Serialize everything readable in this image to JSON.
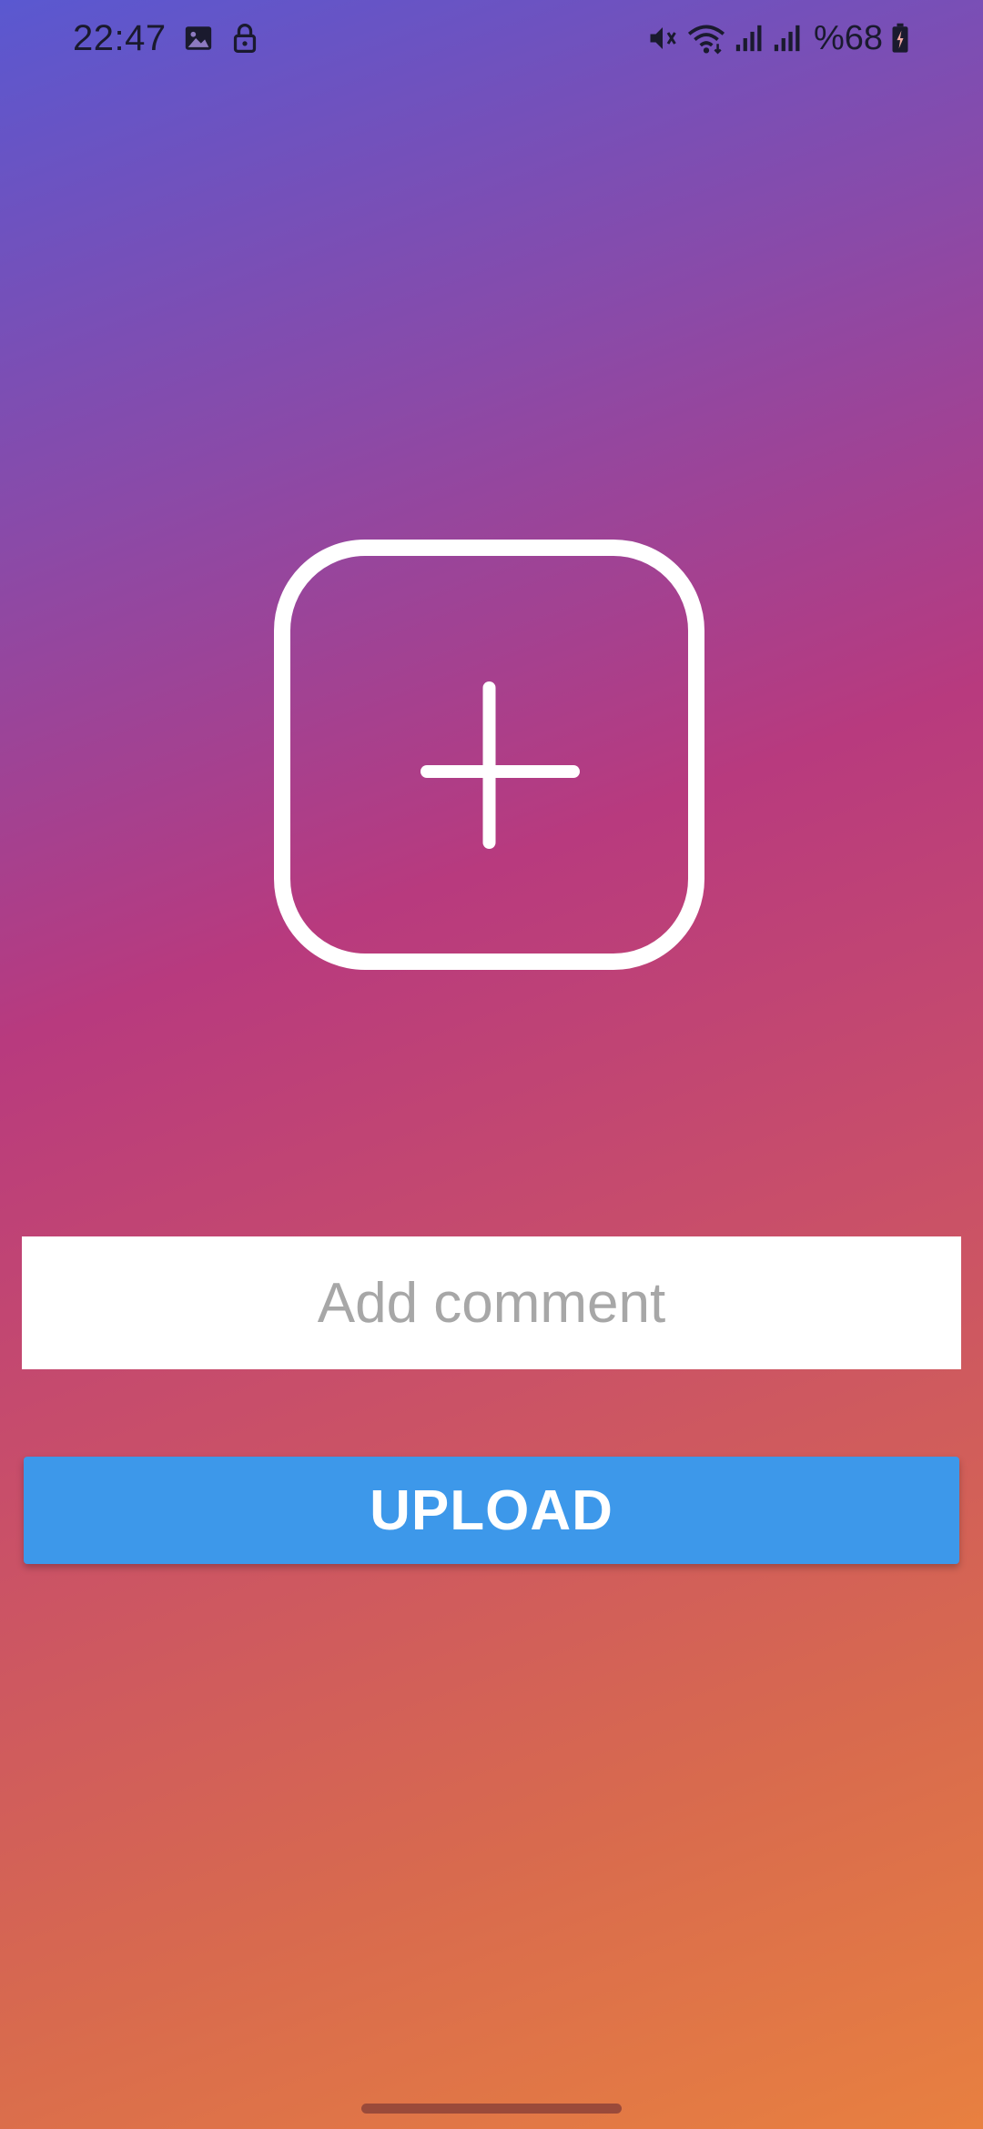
{
  "status_bar": {
    "time": "22:47",
    "battery_text": "%68",
    "icons": [
      "image-icon",
      "lock-icon",
      "mute-icon",
      "wifi-icon",
      "signal-icon",
      "signal-icon",
      "battery-icon"
    ]
  },
  "add_photo": {
    "icon": "plus-icon",
    "color": "#ffffff"
  },
  "comment": {
    "placeholder": "Add comment",
    "value": ""
  },
  "upload": {
    "label": "UPLOAD",
    "color": "#3d98ea"
  },
  "colors": {
    "gradient_start": "#5a58d0",
    "gradient_mid": "#b83a7e",
    "gradient_end": "#e88040"
  }
}
